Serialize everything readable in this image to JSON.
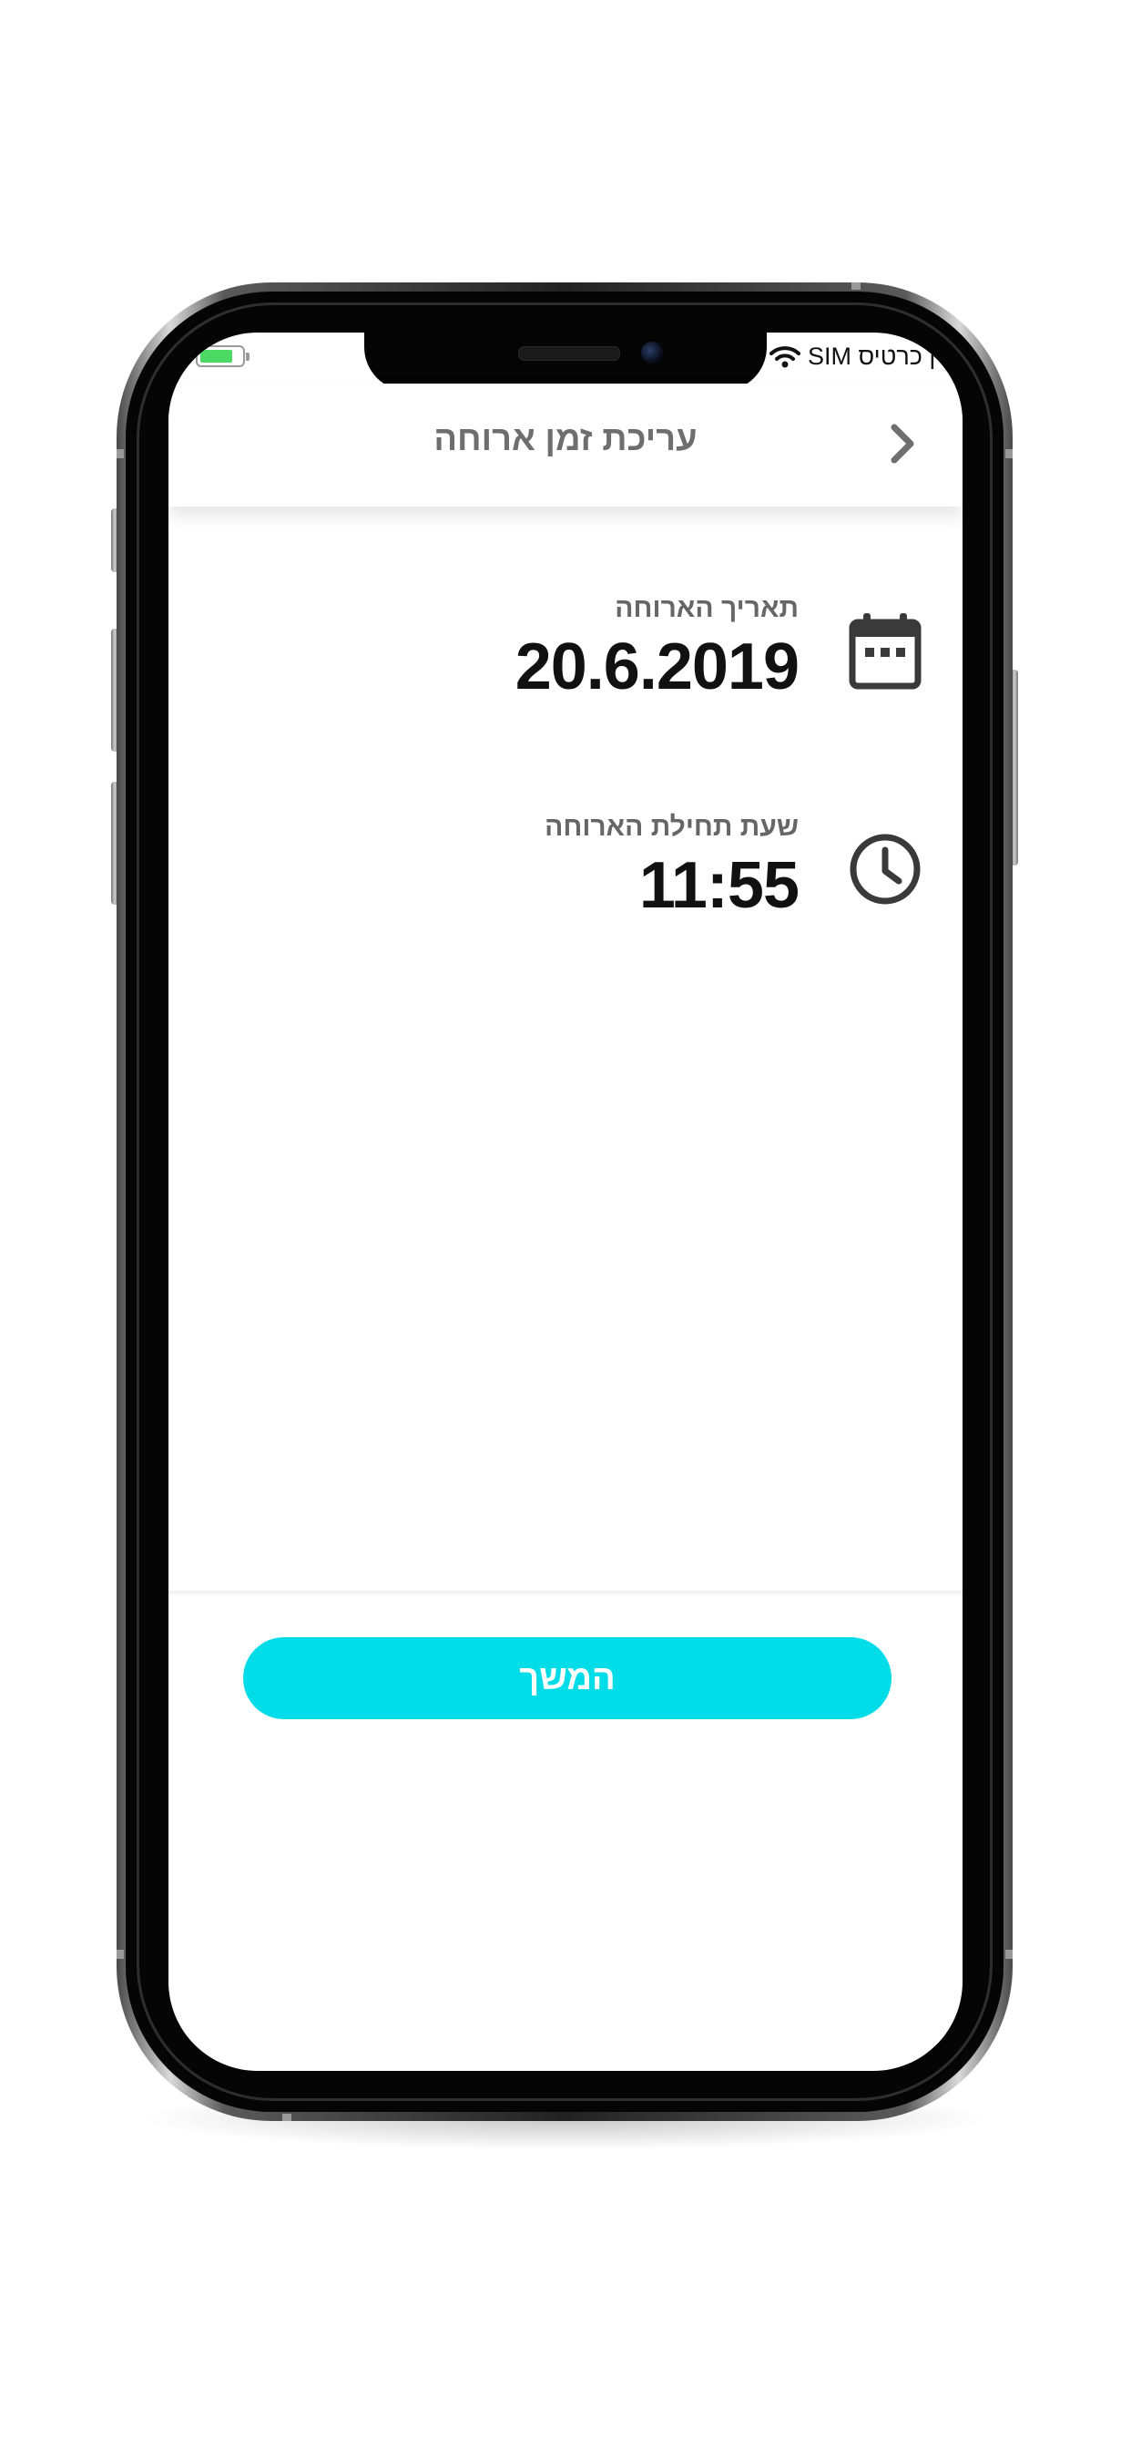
{
  "status_bar": {
    "carrier": "אין כרטיס SIM"
  },
  "header": {
    "title": "עריכת זמן ארוחה"
  },
  "meal_date": {
    "label": "תאריך הארוחה",
    "value": "20.6.2019"
  },
  "meal_time": {
    "label": "שעת תחילת הארוחה",
    "value": "11:55"
  },
  "continue_button": {
    "label": "המשך"
  },
  "colors": {
    "accent": "#00dde8",
    "battery": "#4cd964",
    "title": "#6e6e6e"
  }
}
